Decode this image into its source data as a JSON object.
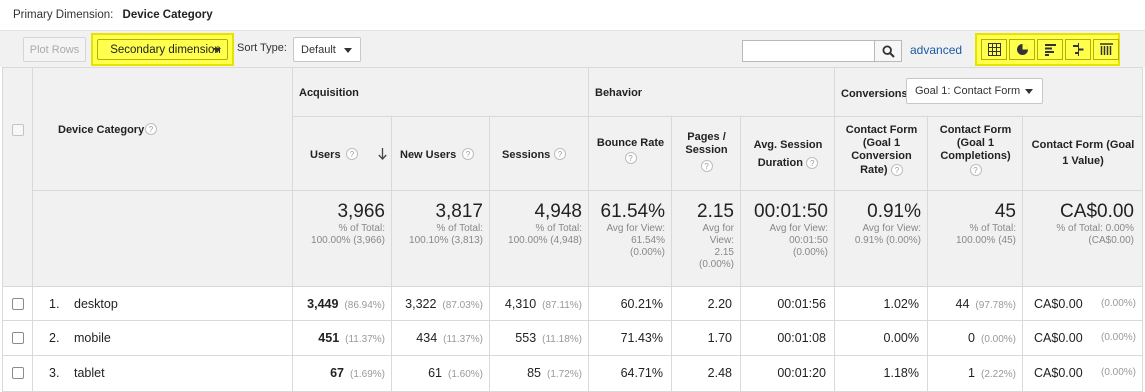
{
  "primary_dimension": {
    "label": "Primary Dimension:",
    "value": "Device Category"
  },
  "toolbar": {
    "plot_rows": "Plot Rows",
    "secondary_dimension": "Secondary dimension",
    "sort_type_label": "Sort Type:",
    "sort_type_value": "Default",
    "search_value": "",
    "advanced": "advanced",
    "view_icons": [
      "data-table-icon",
      "pie-chart-icon",
      "performance-bar-icon",
      "comparison-icon",
      "pivot-icon"
    ],
    "highlight_color": "#ffff4d"
  },
  "table": {
    "dimension_header": "Device Category",
    "groups": {
      "acquisition": "Acquisition",
      "behavior": "Behavior",
      "conversions": "Conversions",
      "goal_select": "Goal 1: Contact Form"
    },
    "columns": {
      "users": "Users",
      "new_users": "New Users",
      "sessions": "Sessions",
      "bounce_rate": "Bounce Rate",
      "pages_session": [
        "Pages /",
        "Session"
      ],
      "avg_session": [
        "Avg. Session",
        "Duration"
      ],
      "conv_rate": [
        "Contact Form",
        "(Goal 1",
        "Conversion",
        "Rate)"
      ],
      "completions": [
        "Contact Form",
        "(Goal 1",
        "Completions)"
      ],
      "value": [
        "Contact Form (Goal",
        "1 Value)"
      ]
    },
    "totals": {
      "users": {
        "value": "3,966",
        "sub": [
          "% of Total:",
          "100.00% (3,966)"
        ]
      },
      "new_users": {
        "value": "3,817",
        "sub": [
          "% of Total:",
          "100.10% (3,813)"
        ]
      },
      "sessions": {
        "value": "4,948",
        "sub": [
          "% of Total:",
          "100.00% (4,948)"
        ]
      },
      "bounce_rate": {
        "value": "61.54%",
        "sub": [
          "Avg for View:",
          "61.54%",
          "(0.00%)"
        ]
      },
      "pages_session": {
        "value": "2.15",
        "sub": [
          "Avg for",
          "View:",
          "2.15",
          "(0.00%)"
        ]
      },
      "avg_session": {
        "value": "00:01:50",
        "sub": [
          "Avg for View:",
          "00:01:50",
          "(0.00%)"
        ]
      },
      "conv_rate": {
        "value": "0.91%",
        "sub": [
          "Avg for View:",
          "0.91% (0.00%)"
        ]
      },
      "completions": {
        "value": "45",
        "sub": [
          "% of Total:",
          "100.00% (45)"
        ]
      },
      "value": {
        "value": "CA$0.00",
        "sub": [
          "% of Total: 0.00%",
          "(CA$0.00)"
        ]
      }
    },
    "rows": [
      {
        "index": "1.",
        "label": "desktop",
        "users": "3,449",
        "users_pct": "(86.94%)",
        "new_users": "3,322",
        "new_users_pct": "(87.03%)",
        "sessions": "4,310",
        "sessions_pct": "(87.11%)",
        "bounce_rate": "60.21%",
        "pages_session": "2.20",
        "avg_session": "00:01:56",
        "conv_rate": "1.02%",
        "completions": "44",
        "completions_pct": "(97.78%)",
        "value": "CA$0.00",
        "value_pct": "(0.00%)"
      },
      {
        "index": "2.",
        "label": "mobile",
        "users": "451",
        "users_pct": "(11.37%)",
        "new_users": "434",
        "new_users_pct": "(11.37%)",
        "sessions": "553",
        "sessions_pct": "(11.18%)",
        "bounce_rate": "71.43%",
        "pages_session": "1.70",
        "avg_session": "00:01:08",
        "conv_rate": "0.00%",
        "completions": "0",
        "completions_pct": "(0.00%)",
        "value": "CA$0.00",
        "value_pct": "(0.00%)"
      },
      {
        "index": "3.",
        "label": "tablet",
        "users": "67",
        "users_pct": "(1.69%)",
        "new_users": "61",
        "new_users_pct": "(1.60%)",
        "sessions": "85",
        "sessions_pct": "(1.72%)",
        "bounce_rate": "64.71%",
        "pages_session": "2.48",
        "avg_session": "00:01:20",
        "conv_rate": "1.18%",
        "completions": "1",
        "completions_pct": "(2.22%)",
        "value": "CA$0.00",
        "value_pct": "(0.00%)"
      }
    ]
  }
}
